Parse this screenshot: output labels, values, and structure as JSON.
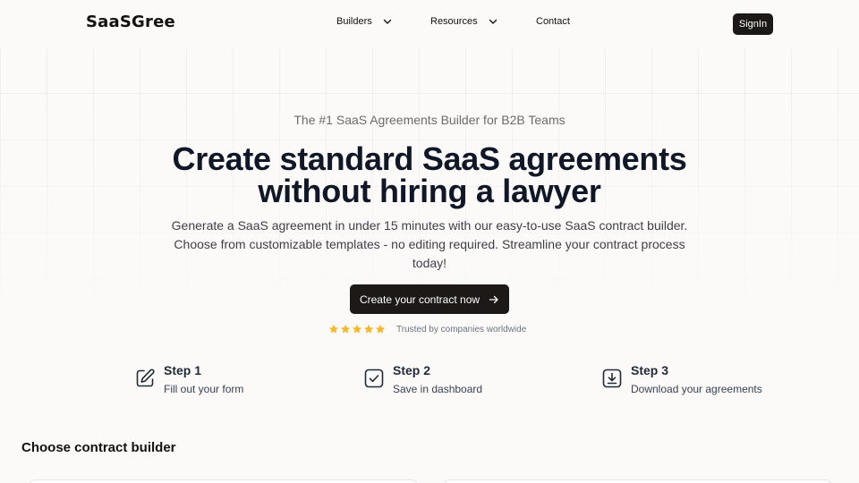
{
  "brand": {
    "name": "SaaSGree"
  },
  "nav": {
    "items": [
      {
        "label": "Builders",
        "has_dropdown": true
      },
      {
        "label": "Resources",
        "has_dropdown": true
      },
      {
        "label": "Contact",
        "has_dropdown": false
      }
    ],
    "signin_label": "SignIn"
  },
  "hero": {
    "eyebrow": "The #1 SaaS Agreements Builder for B2B Teams",
    "headline_line1": "Create standard SaaS agreements",
    "headline_line2": "without hiring a lawyer",
    "subtitle": "Generate a SaaS agreement in under 15 minutes with our easy-to-use SaaS contract builder. Choose from customizable templates - no editing required. Streamline your contract process today!",
    "cta_label": "Create your contract now",
    "rating_stars": 5,
    "trust_text": "Trusted by companies worldwide"
  },
  "steps": [
    {
      "title": "Step 1",
      "desc": "Fill out your form",
      "icon": "edit-icon"
    },
    {
      "title": "Step 2",
      "desc": "Save in dashboard",
      "icon": "check-square-icon"
    },
    {
      "title": "Step 3",
      "desc": "Download your agreements",
      "icon": "download-icon"
    }
  ],
  "builders_section": {
    "title": "Choose contract builder"
  },
  "colors": {
    "background": "#fbfaf9",
    "primary_dark": "#1c1917",
    "star": "#f5b82e",
    "headline": "#101828"
  }
}
